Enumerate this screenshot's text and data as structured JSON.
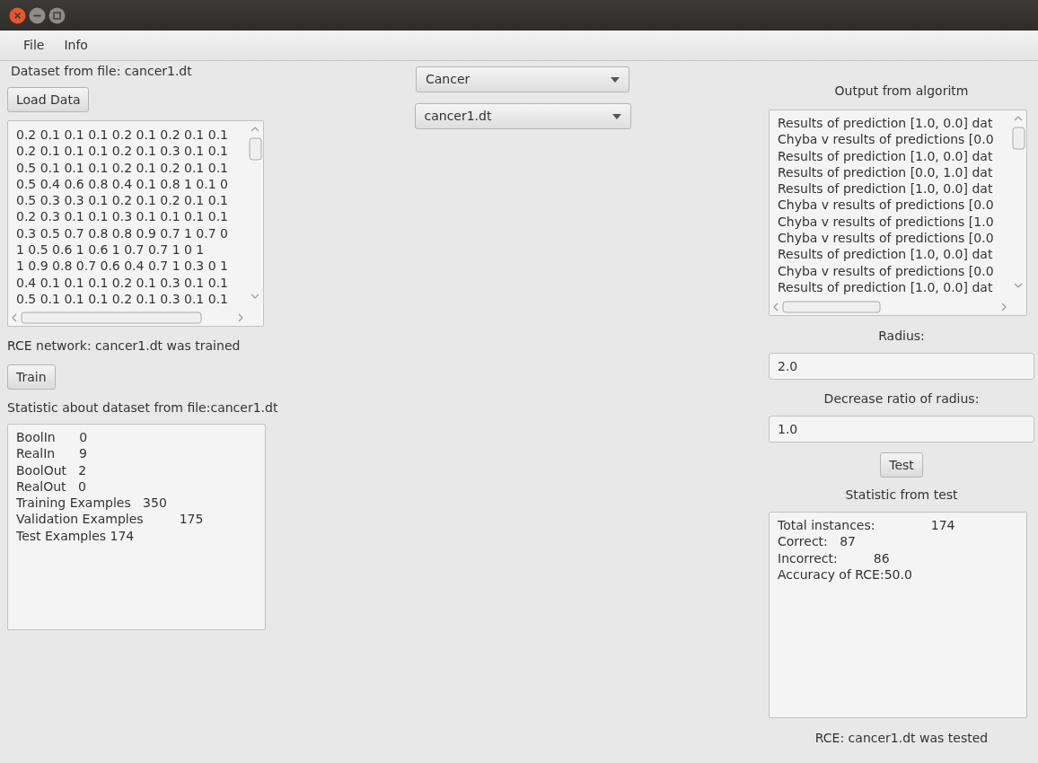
{
  "window": {
    "title_bar_buttons": [
      {
        "kind": "close"
      },
      {
        "kind": "minimize"
      },
      {
        "kind": "maximize"
      }
    ]
  },
  "menu": [
    {
      "label": "File"
    },
    {
      "label": "Info"
    }
  ],
  "left": {
    "dataset_label": "Dataset from file: cancer1.dt",
    "load_button": "Load Data",
    "data_rows": [
      "0.2 0.1 0.1 0.1 0.2 0.1 0.2 0.1 0.1",
      "0.2 0.1 0.1 0.1 0.2 0.1 0.3 0.1 0.1",
      "0.5 0.1 0.1 0.1 0.2 0.1 0.2 0.1 0.1",
      "0.5 0.4 0.6 0.8 0.4 0.1 0.8 1 0.1 0",
      "0.5 0.3 0.3 0.1 0.2 0.1 0.2 0.1 0.1",
      "0.2 0.3 0.1 0.1 0.3 0.1 0.1 0.1 0.1",
      "0.3 0.5 0.7 0.8 0.8 0.9 0.7 1 0.7 0",
      "1 0.5 0.6 1 0.6 1 0.7 0.7 1 0 1",
      "1 0.9 0.8 0.7 0.6 0.4 0.7 1 0.3 0 1",
      "0.4 0.1 0.1 0.1 0.2 0.1 0.3 0.1 0.1",
      "0.5 0.1 0.1 0.1 0.2 0.1 0.3 0.1 0.1"
    ],
    "train_status": "RCE network: cancer1.dt was trained",
    "train_button": "Train",
    "stats_label": "Statistic about dataset from file:cancer1.dt",
    "stats_lines": [
      "BoolIn      0",
      "RealIn      9",
      "BoolOut   2",
      "RealOut   0",
      "Training Examples   350",
      "Validation Examples         175",
      "Test Examples 174"
    ]
  },
  "middle": {
    "dataset_select": "Cancer",
    "file_select": "cancer1.dt"
  },
  "right": {
    "output_label": "Output from algoritm",
    "output_rows": [
      "Results of prediction [1.0, 0.0] dat",
      "Chyba v results of predictions [0.0",
      "Results of prediction [1.0, 0.0] dat",
      "Results of prediction [0.0, 1.0] dat",
      "Results of prediction [1.0, 0.0] dat",
      "Chyba v results of predictions [0.0",
      "Chyba v results of predictions [1.0",
      "Chyba v results of predictions [0.0",
      "Results of prediction [1.0, 0.0] dat",
      "Chyba v results of predictions [0.0",
      "Results of prediction [1.0, 0.0] dat"
    ],
    "radius_label": "Radius:",
    "radius_value": "2.0",
    "decrease_label": "Decrease ratio of radius:",
    "decrease_value": "1.0",
    "test_button": "Test",
    "test_stats_label": "Statistic from test",
    "test_stats_lines": [
      "Total instances:              174",
      "Correct:   87",
      "Incorrect:         86",
      "Accuracy of RCE:50.0"
    ],
    "status": "RCE: cancer1.dt was tested"
  }
}
